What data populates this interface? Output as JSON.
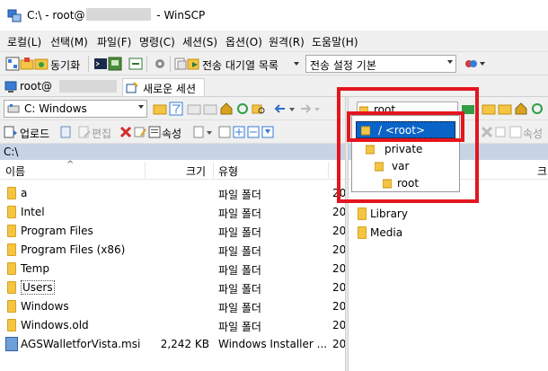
{
  "window": {
    "title_prefix": "C:\\ - root@",
    "title_suffix": " - WinSCP"
  },
  "menu": [
    "로컬(L)",
    "선택(M)",
    "파일(F)",
    "명령(C)",
    "세션(S)",
    "옵션(O)",
    "원격(R)",
    "도움말(H)"
  ],
  "toolbar": {
    "sync_label": "동기화",
    "queue_label": "전송 대기열 목록",
    "transfer_setting": "전송 설정 기본"
  },
  "tabs": {
    "session_prefix": "root@",
    "new_session": "새로운 세션"
  },
  "left": {
    "drive": "C: Windows",
    "upload_label": "업로드",
    "edit_label": "편집",
    "props_label": "속성",
    "path": "C:\\",
    "col_name": "이름",
    "col_size": "크기",
    "col_type": "유형",
    "rows": [
      {
        "name": "a",
        "size": "",
        "type": "파일 폴더",
        "date": "20",
        "kind": "folder"
      },
      {
        "name": "Intel",
        "size": "",
        "type": "파일 폴더",
        "date": "20",
        "kind": "folder"
      },
      {
        "name": "Program Files",
        "size": "",
        "type": "파일 폴더",
        "date": "20",
        "kind": "folder"
      },
      {
        "name": "Program Files (x86)",
        "size": "",
        "type": "파일 폴더",
        "date": "20",
        "kind": "folder"
      },
      {
        "name": "Temp",
        "size": "",
        "type": "파일 폴더",
        "date": "20",
        "kind": "folder"
      },
      {
        "name": "Users",
        "size": "",
        "type": "파일 폴더",
        "date": "20",
        "kind": "folder"
      },
      {
        "name": "Windows",
        "size": "",
        "type": "파일 폴더",
        "date": "20",
        "kind": "folder"
      },
      {
        "name": "Windows.old",
        "size": "",
        "type": "파일 폴더",
        "date": "20",
        "kind": "folder"
      },
      {
        "name": "AGSWalletforVista.msi",
        "size": "2,242 KB",
        "type": "Windows Installer ...",
        "date": "20",
        "kind": "file"
      }
    ]
  },
  "right": {
    "path_combo": "root",
    "path_letter": "/",
    "col_size": "크",
    "rows": [
      "Library",
      "Media"
    ],
    "dropdown": {
      "root_item": "/ <root>",
      "items": [
        "private",
        "var",
        "root"
      ]
    }
  }
}
